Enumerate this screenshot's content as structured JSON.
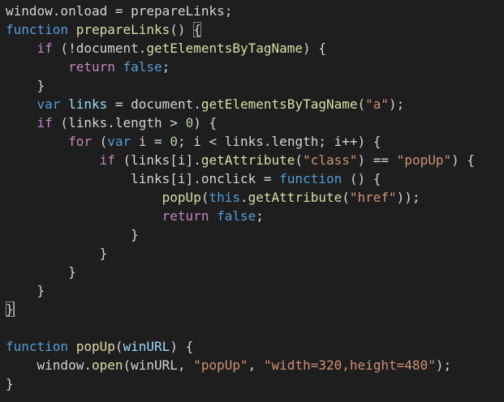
{
  "editor": {
    "colors": {
      "background": "#1e1e1e",
      "plain": "#d4d4d4",
      "keyword": "#569cd6",
      "control": "#c586c0",
      "function": "#dcdcaa",
      "variable": "#9cdcfe",
      "string": "#ce9178",
      "number": "#b5cea8"
    },
    "cursor_line": 16,
    "lines": [
      [
        [
          "plain",
          "window.onload = prepareLinks;"
        ]
      ],
      [
        [
          "keyword",
          "function"
        ],
        [
          "plain",
          " "
        ],
        [
          "function",
          "prepareLinks"
        ],
        [
          "plain",
          "() "
        ],
        [
          "bracket-match",
          "{"
        ]
      ],
      [
        [
          "plain",
          "    "
        ],
        [
          "control",
          "if"
        ],
        [
          "plain",
          " (!document."
        ],
        [
          "function",
          "getElementsByTagName"
        ],
        [
          "plain",
          ") {"
        ]
      ],
      [
        [
          "plain",
          "        "
        ],
        [
          "control",
          "return"
        ],
        [
          "plain",
          " "
        ],
        [
          "keyword",
          "false"
        ],
        [
          "plain",
          ";"
        ]
      ],
      [
        [
          "plain",
          "    }"
        ]
      ],
      [
        [
          "plain",
          "    "
        ],
        [
          "keyword",
          "var"
        ],
        [
          "plain",
          " "
        ],
        [
          "variable",
          "links"
        ],
        [
          "plain",
          " = document."
        ],
        [
          "function",
          "getElementsByTagName"
        ],
        [
          "plain",
          "("
        ],
        [
          "string",
          "\"a\""
        ],
        [
          "plain",
          ");"
        ]
      ],
      [
        [
          "plain",
          "    "
        ],
        [
          "control",
          "if"
        ],
        [
          "plain",
          " (links.length > "
        ],
        [
          "number",
          "0"
        ],
        [
          "plain",
          ") {"
        ]
      ],
      [
        [
          "plain",
          "        "
        ],
        [
          "control",
          "for"
        ],
        [
          "plain",
          " ("
        ],
        [
          "keyword",
          "var"
        ],
        [
          "plain",
          " i = "
        ],
        [
          "number",
          "0"
        ],
        [
          "plain",
          "; i < links.length; i++) {"
        ]
      ],
      [
        [
          "plain",
          "            "
        ],
        [
          "control",
          "if"
        ],
        [
          "plain",
          " (links[i]."
        ],
        [
          "function",
          "getAttribute"
        ],
        [
          "plain",
          "("
        ],
        [
          "string",
          "\"class\""
        ],
        [
          "plain",
          ") == "
        ],
        [
          "string",
          "\"popUp\""
        ],
        [
          "plain",
          ") {"
        ]
      ],
      [
        [
          "plain",
          "                links[i].onclick = "
        ],
        [
          "keyword",
          "function"
        ],
        [
          "plain",
          " () {"
        ]
      ],
      [
        [
          "plain",
          "                    "
        ],
        [
          "function",
          "popUp"
        ],
        [
          "plain",
          "("
        ],
        [
          "keyword",
          "this"
        ],
        [
          "plain",
          "."
        ],
        [
          "function",
          "getAttribute"
        ],
        [
          "plain",
          "("
        ],
        [
          "string",
          "\"href\""
        ],
        [
          "plain",
          "));"
        ]
      ],
      [
        [
          "plain",
          "                    "
        ],
        [
          "control",
          "return"
        ],
        [
          "plain",
          " "
        ],
        [
          "keyword",
          "false"
        ],
        [
          "plain",
          ";"
        ]
      ],
      [
        [
          "plain",
          "                }"
        ]
      ],
      [
        [
          "plain",
          "            }"
        ]
      ],
      [
        [
          "plain",
          "        }"
        ]
      ],
      [
        [
          "plain",
          "    }"
        ]
      ],
      [
        [
          "bracket-match",
          "}"
        ]
      ],
      [],
      [
        [
          "keyword",
          "function"
        ],
        [
          "plain",
          " "
        ],
        [
          "function",
          "popUp"
        ],
        [
          "plain",
          "("
        ],
        [
          "variable",
          "winURL"
        ],
        [
          "plain",
          ") {"
        ]
      ],
      [
        [
          "plain",
          "    window."
        ],
        [
          "function",
          "open"
        ],
        [
          "plain",
          "(winURL, "
        ],
        [
          "string",
          "\"popUp\""
        ],
        [
          "plain",
          ", "
        ],
        [
          "string",
          "\"width=320,height=480\""
        ],
        [
          "plain",
          ");"
        ]
      ],
      [
        [
          "plain",
          "}"
        ]
      ]
    ]
  }
}
